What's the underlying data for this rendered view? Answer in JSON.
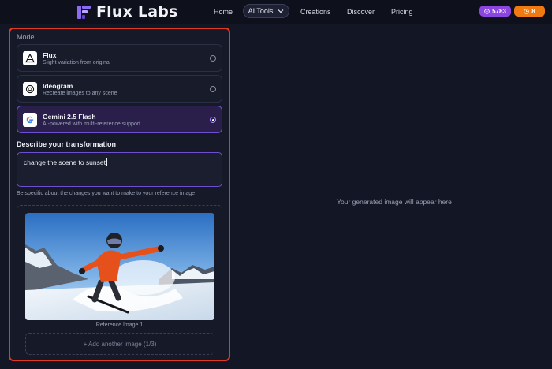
{
  "brand": {
    "name": "Flux Labs"
  },
  "nav": {
    "links": [
      "Home",
      "Creations",
      "Discover",
      "Pricing"
    ],
    "ai_tools": "AI Tools"
  },
  "badges": {
    "credits": "5783",
    "coins": "8"
  },
  "colors": {
    "accent": "#8b45e0",
    "coins": "#f07a12",
    "panel_border": "#e23a22",
    "selected": "#6e4fd1"
  },
  "panel": {
    "model_label": "Model",
    "models": [
      {
        "name": "Flux",
        "description": "Slight variation from original",
        "icon": "flux-logo-icon",
        "selected": false
      },
      {
        "name": "Ideogram",
        "description": "Recreate images to any scene",
        "icon": "ideogram-logo-icon",
        "selected": false
      },
      {
        "name": "Gemini 2.5 Flash",
        "description": "AI-powered with multi-reference support",
        "icon": "google-logo-icon",
        "selected": true
      }
    ],
    "transform_label": "Describe your transformation",
    "prompt_value": "change the scene to sunset",
    "helper_text": "Be specific about the changes you want to make to your reference image",
    "reference_caption": "Reference Image 1",
    "add_image": "+ Add another image (1/3)"
  },
  "output": {
    "placeholder": "Your generated image will appear here"
  }
}
